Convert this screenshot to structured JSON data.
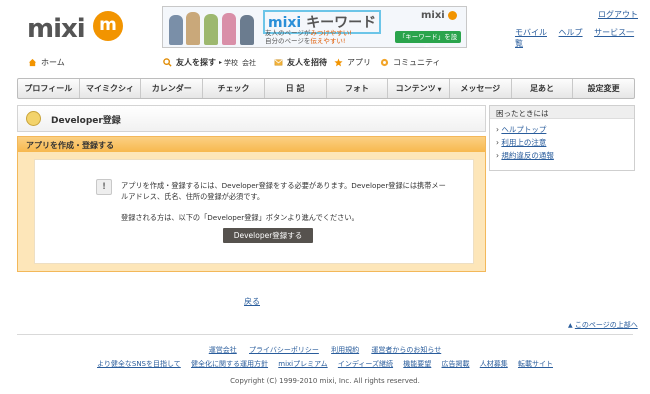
{
  "header": {
    "logo_text": "mixi",
    "logo_badge": "m",
    "logout": "ログアウト",
    "top_links": [
      "モバイル",
      "ヘルプ",
      "サービス一覧"
    ]
  },
  "banner": {
    "title_prefix": "mixi",
    "title_keyword": "キーワード",
    "line1_a": "友人のページが",
    "line1_b": "みつけやすい!",
    "line2_a": "自分のページを",
    "line2_b": "伝えやすい!",
    "brand": "mixi",
    "button": "「キーワード」を設定!"
  },
  "subnav": {
    "home": "ホーム",
    "find_friends": "友人を探す",
    "school": "学校",
    "company": "会社",
    "invite": "友人を招待",
    "app": "アプリ",
    "community": "コミュニティ"
  },
  "gnav": [
    "プロフィール",
    "マイミクシィ",
    "カレンダー",
    "チェック",
    "日 記",
    "フォト",
    "コンテンツ",
    "メッセージ",
    "足あと",
    "設定変更"
  ],
  "page": {
    "title": "Developer登録",
    "section_title": "アプリを作成・登録する",
    "message1": "アプリを作成・登録するには、Developer登録をする必要があります。Developer登録には携帯メールアドレス、氏名、住所の登録が必須です。",
    "message2": "登録される方は、以下の「Developer登録」ボタンより進んでください。",
    "register_button": "Developer登録する",
    "back": "戻る",
    "page_top": "このページの上部へ"
  },
  "help": {
    "title": "困ったときには",
    "links": [
      "ヘルプトップ",
      "利用上の注意",
      "規約違反の通報"
    ]
  },
  "footer": {
    "row1": [
      "運営会社",
      "プライバシーポリシー",
      "利用規約",
      "運営者からのお知らせ"
    ],
    "row2": [
      "より健全なSNSを目指して",
      "健全化に関する運用方針",
      "mixiプレミアム",
      "インディーズ継続",
      "機能要望",
      "広告掲載",
      "人材募集",
      "転載サイト"
    ],
    "copyright": "Copyright (C) 1999-2010 mixi, Inc. All rights reserved."
  }
}
